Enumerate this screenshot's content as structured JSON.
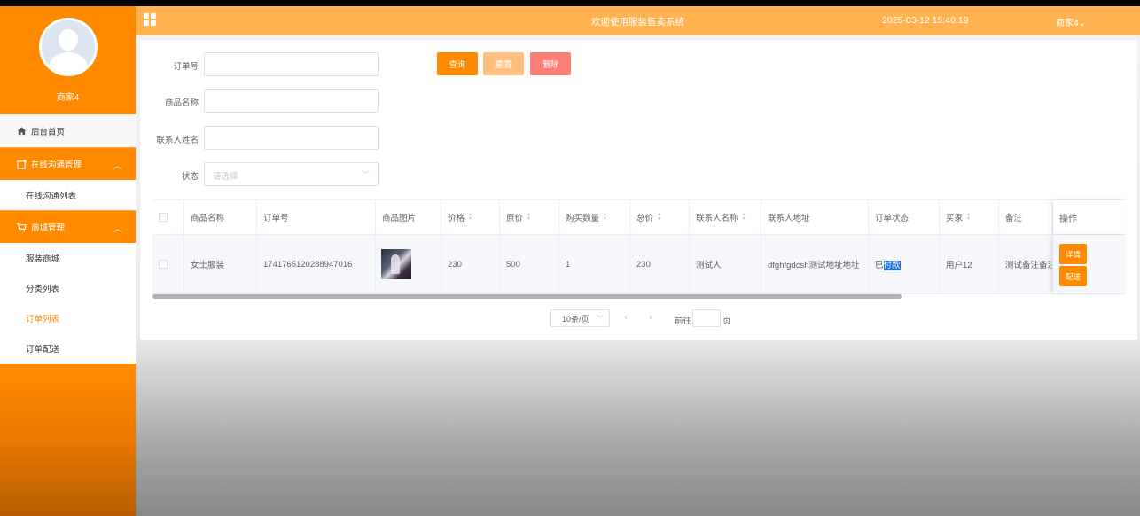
{
  "header": {
    "title": "欢迎使用服装售卖系统",
    "datetime": "2025-03-12 15:40:19",
    "user_menu": "商家4⌄"
  },
  "sidebar": {
    "username": "商家4",
    "home": "后台首页",
    "groups": [
      {
        "label": "在线沟通管理",
        "icon": "chat-icon",
        "items": [
          "在线沟通列表"
        ]
      },
      {
        "label": "商城管理",
        "icon": "cart-icon",
        "items": [
          "服装商城",
          "分类列表",
          "订单列表",
          "订单配送"
        ]
      }
    ],
    "active_item": "订单列表"
  },
  "filters": {
    "order_no_label": "订单号",
    "product_name_label": "商品名称",
    "contact_name_label": "联系人姓名",
    "status_label": "状态",
    "status_placeholder": "请选择"
  },
  "buttons": {
    "query": "查询",
    "reset": "重置",
    "delete": "删除"
  },
  "table": {
    "columns": [
      "商品名称",
      "订单号",
      "商品图片",
      "价格",
      "原价",
      "购买数量",
      "总价",
      "联系人名称",
      "联系人地址",
      "订单状态",
      "买家",
      "备注",
      "操作"
    ],
    "rows": [
      {
        "product_name": "女士服装",
        "order_no": "1741765120288947016",
        "price": "230",
        "original_price": "500",
        "quantity": "1",
        "total": "230",
        "contact_name": "测试人",
        "contact_address": "dfghfgdcsh测试地址地址",
        "status_prefix": "已",
        "status_selected": "付款",
        "buyer": "用户12",
        "remark": "测试备注备注",
        "actions": [
          "详情",
          "配送"
        ]
      }
    ]
  },
  "pagination": {
    "page_size": "10条/页",
    "goto_label": "前往",
    "goto_value": "",
    "page_unit": "页"
  },
  "colors": {
    "accent": "#ff8a00",
    "header": "#ffb24f",
    "reset": "#ffbf7f",
    "delete": "#fb7f76"
  }
}
